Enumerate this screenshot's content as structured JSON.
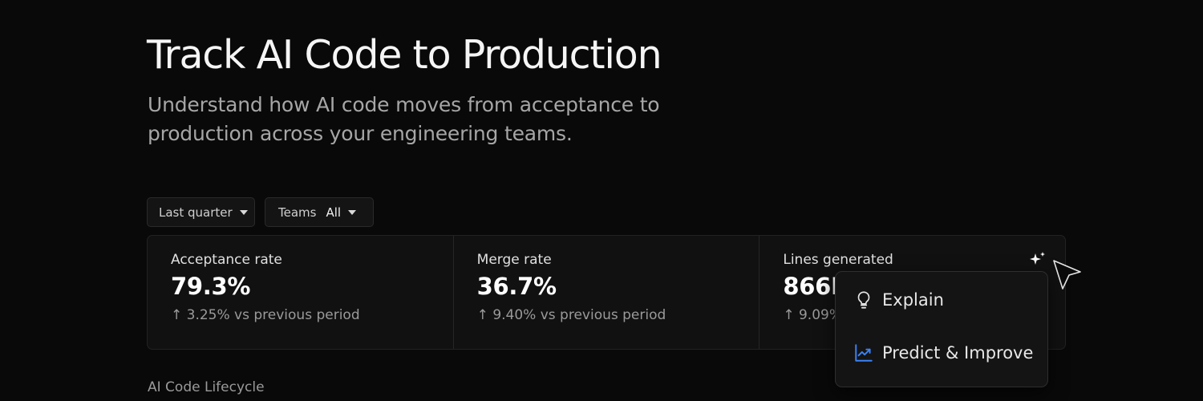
{
  "header": {
    "title": "Track AI Code to Production",
    "subtitle": "Understand how AI code moves from acceptance to production across your engineering teams."
  },
  "filters": {
    "period": {
      "value": "Last quarter"
    },
    "teams": {
      "label": "Teams",
      "value": "All"
    }
  },
  "metrics": [
    {
      "label": "Acceptance rate",
      "value": "79.3%",
      "change": "↑ 3.25% vs previous period"
    },
    {
      "label": "Merge rate",
      "value": "36.7%",
      "change": "↑ 9.40% vs previous period"
    },
    {
      "label": "Lines generated",
      "value": "866K",
      "change": "↑ 9.09%"
    }
  ],
  "ai_menu": {
    "items": [
      {
        "label": "Explain",
        "icon": "lightbulb-icon"
      },
      {
        "label": "Predict & Improve",
        "icon": "trending-up-icon"
      }
    ]
  },
  "section": {
    "label": "AI Code Lifecycle"
  },
  "colors": {
    "background": "#090909",
    "accent": "#3b82f6"
  }
}
